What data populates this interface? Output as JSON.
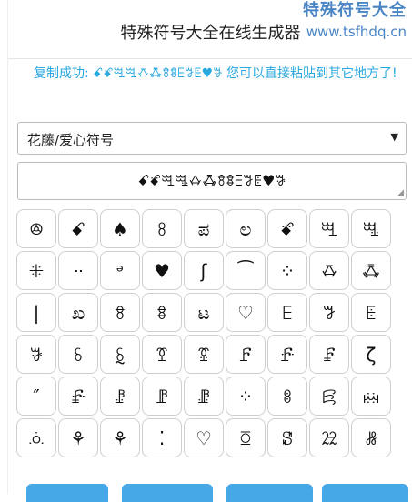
{
  "watermark": {
    "line1": "特殊符号大全",
    "line2": "www.tsfhdq.cn"
  },
  "title": "特殊符号大全在线生成器",
  "success_message": "复制成功: ꗃꗄꗅꗆꗇꗈꗉꗊꗋꗌꗍ♥ꗎ 您可以直接粘贴到其它地方了!",
  "select": {
    "selected": "花藤/爱心符号",
    "arrow": "▼"
  },
  "output_value": "ꗃꗄꗅꗆꗇꗈꗉꗊꗋꗌꗍ♥ꗎ",
  "symbols": [
    "ꔮ",
    "ꗃ",
    "♠",
    "ꗉ",
    "ಪ",
    "ಲ",
    "ꗄ",
    "ꗅ",
    "ꗆ",
    "ꔰ",
    "ᐧᐧ",
    "ᵊ",
    "♥",
    "ʃ",
    "⁀",
    "⁘",
    "ꗇ",
    "ꗈ",
    "|",
    "ಖ",
    "ꗉ",
    "ꗊ",
    "ಟ",
    "♡",
    "ꗋ",
    "ꗌ",
    "ꗍ",
    "ꗎ",
    "ꗏ",
    "ꗐ",
    "ꗑ",
    "ꗒ",
    "ꗓ",
    "ꗔ",
    "ꗕ",
    "ζ",
    "″",
    "ꗖ",
    "ꗗ",
    "ꗘ",
    "ꗙ",
    "⁘",
    "ꗚ",
    "ꗛ",
    "ꗜ",
    "ꗝ",
    "⚘",
    "⚘",
    "⁚",
    "♡",
    "ꗞ",
    "ꗟ",
    "ꗠ",
    "ꗡ"
  ],
  "colors": {
    "accent": "#29a8e0",
    "watermark": "#4a86c5"
  }
}
